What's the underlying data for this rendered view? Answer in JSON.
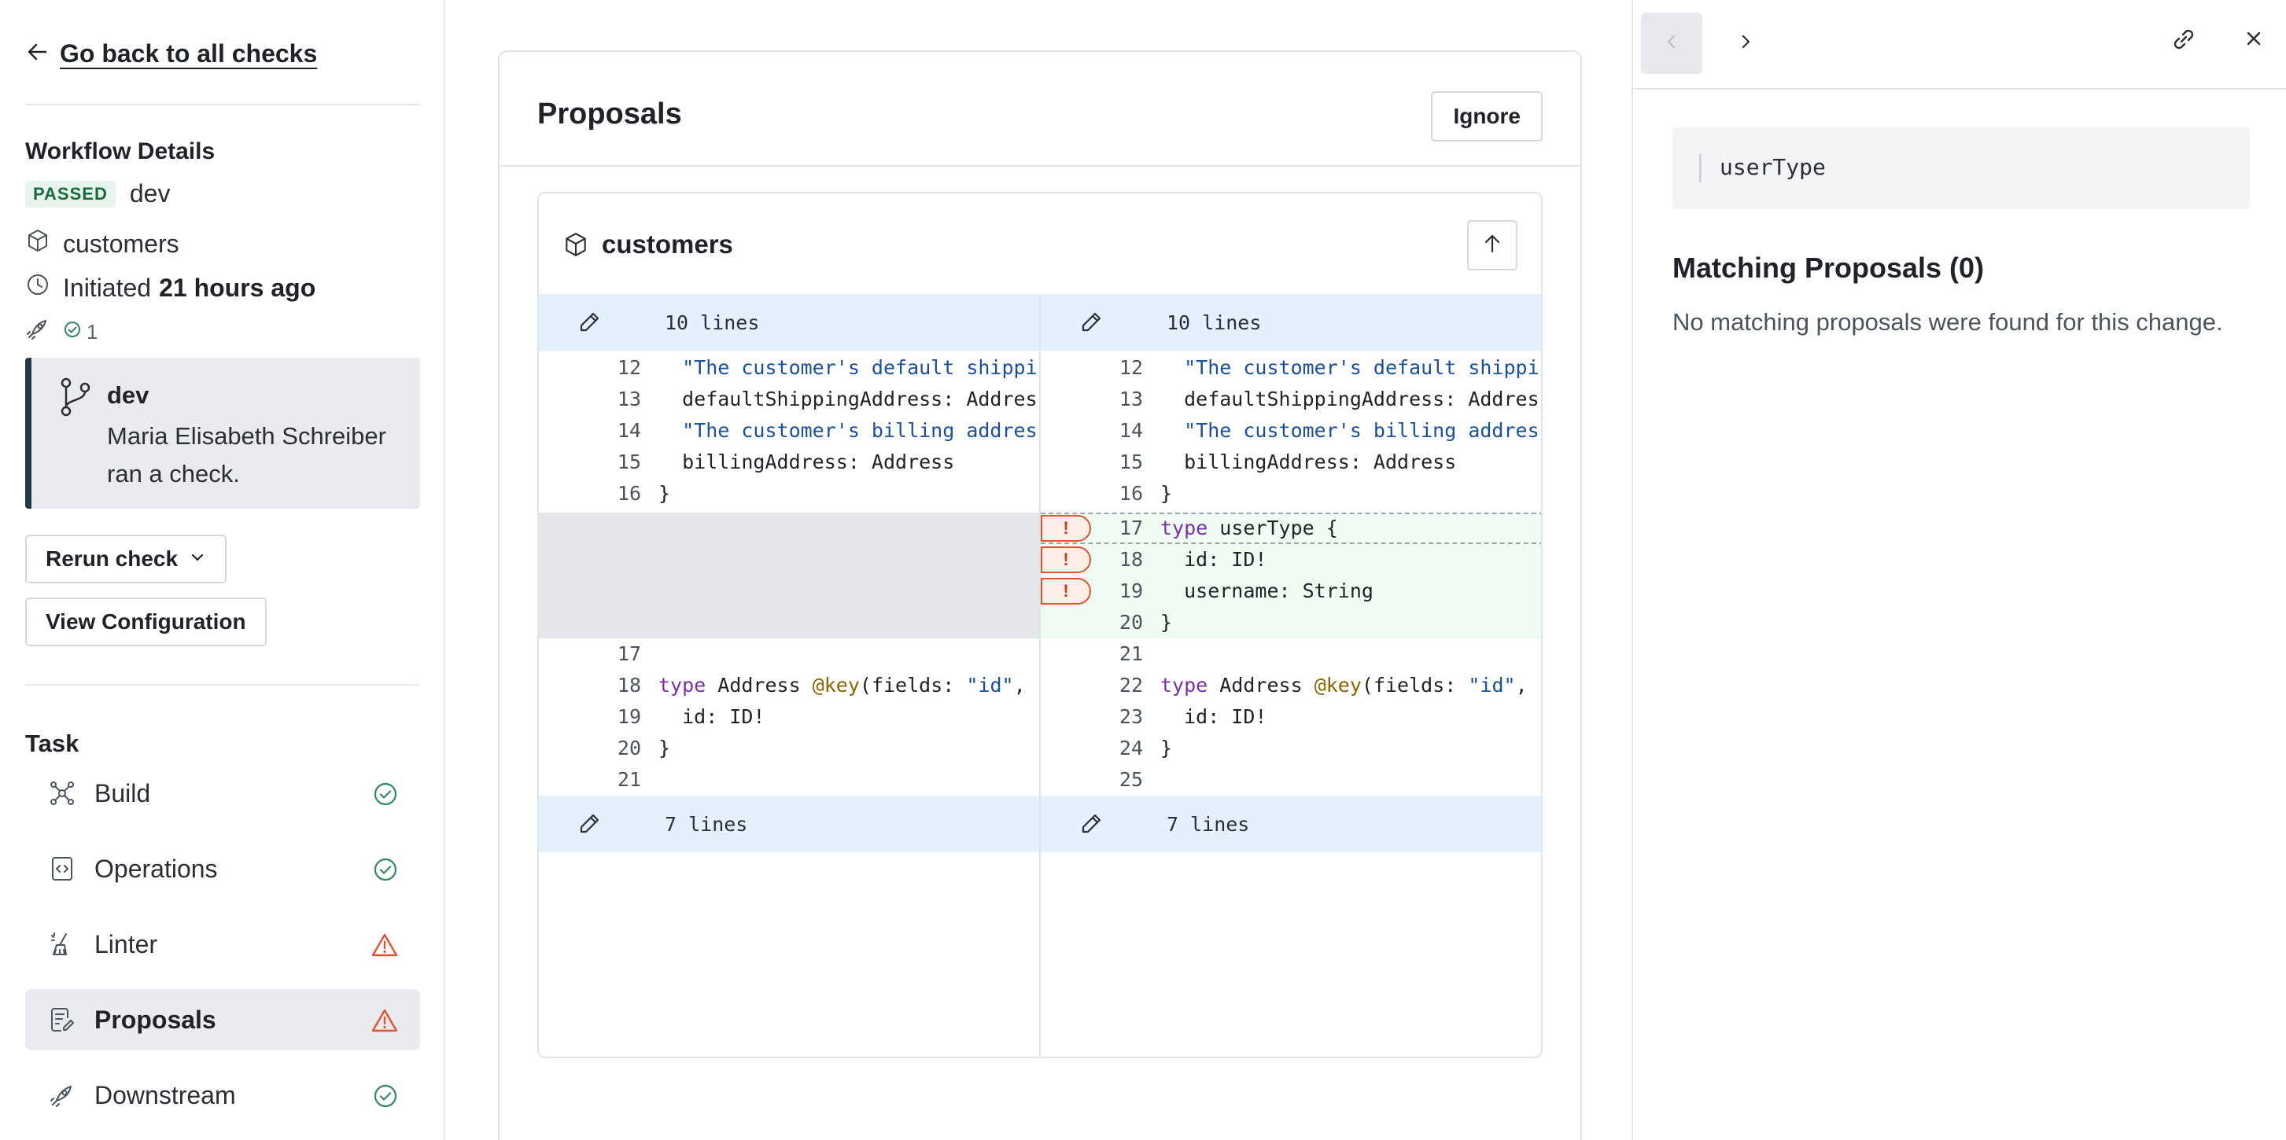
{
  "sidebar": {
    "back_label": "Go back to all checks",
    "workflow_title": "Workflow Details",
    "status_badge": "PASSED",
    "environment": "dev",
    "subgraph": "customers",
    "initiated_prefix": "Initiated",
    "initiated_time": "21 hours ago",
    "check_count": "1",
    "branch": {
      "name": "dev",
      "description": "Maria Elisabeth Schreiber ran a check."
    },
    "rerun_label": "Rerun check",
    "view_config_label": "View Configuration",
    "task_title": "Task",
    "tasks": [
      {
        "label": "Build",
        "status": "passed"
      },
      {
        "label": "Operations",
        "status": "passed"
      },
      {
        "label": "Linter",
        "status": "warning"
      },
      {
        "label": "Proposals",
        "status": "warning",
        "active": true
      },
      {
        "label": "Downstream",
        "status": "passed"
      }
    ]
  },
  "main": {
    "title": "Proposals",
    "ignore_label": "Ignore",
    "subgraph_name": "customers",
    "diff": {
      "top_collapsed": "10 lines",
      "bottom_collapsed": "7 lines",
      "left_lines": [
        {
          "num": "12",
          "code": "  \"The customer's default shipping address\""
        },
        {
          "num": "13",
          "code": "  defaultShippingAddress: Address"
        },
        {
          "num": "14",
          "code": "  \"The customer's billing address\""
        },
        {
          "num": "15",
          "code": "  billingAddress: Address"
        },
        {
          "num": "16",
          "code": "}"
        },
        {
          "num": "17",
          "code": ""
        },
        {
          "num": "18",
          "code": "type Address @key(fields: \"id\", resolvable: false) {"
        },
        {
          "num": "19",
          "code": "  id: ID!"
        },
        {
          "num": "20",
          "code": "}"
        },
        {
          "num": "21",
          "code": ""
        }
      ],
      "right_lines": [
        {
          "num": "12",
          "code": "  \"The customer's default shipping address\""
        },
        {
          "num": "13",
          "code": "  defaultShippingAddress: Address"
        },
        {
          "num": "14",
          "code": "  \"The customer's billing address\""
        },
        {
          "num": "15",
          "code": "  billingAddress: Address"
        },
        {
          "num": "16",
          "code": "}"
        },
        {
          "num": "17",
          "code": "type userType {",
          "added": true
        },
        {
          "num": "18",
          "code": "  id: ID!",
          "added": true
        },
        {
          "num": "19",
          "code": "  username: String",
          "added": true
        },
        {
          "num": "20",
          "code": "}",
          "added": true
        },
        {
          "num": "21",
          "code": ""
        },
        {
          "num": "22",
          "code": "type Address @key(fields: \"id\", resolvable: false) {"
        },
        {
          "num": "23",
          "code": "  id: ID!"
        },
        {
          "num": "24",
          "code": "}"
        },
        {
          "num": "25",
          "code": ""
        }
      ],
      "warning_marker": "!"
    }
  },
  "panel": {
    "selected_type": "userType",
    "matching_title": "Matching Proposals (0)",
    "matching_desc": "No matching proposals were found for this change."
  },
  "colors": {
    "passed": "#2f8a57",
    "warning": "#e0532b",
    "branch_accent": "#1f3a48",
    "added_bg": "#eefcf2",
    "collapsed_bg": "#e4f0fb"
  }
}
